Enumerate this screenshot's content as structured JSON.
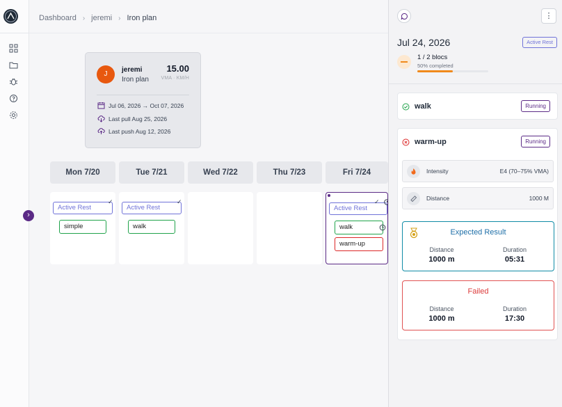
{
  "breadcrumb": {
    "items": [
      "Dashboard",
      "jeremi",
      "Iron plan"
    ]
  },
  "athlete": {
    "initial": "J",
    "name": "jeremi",
    "plan": "Iron plan",
    "vma": "15.00",
    "vma_unit": "VMA · KM/H",
    "date_range": "Jul 06, 2026 → Oct 07, 2026",
    "last_pull": "Last pull Aug 25, 2026",
    "last_push": "Last push Aug 12, 2026"
  },
  "calendar": {
    "days": [
      {
        "label": "Mon 7/20",
        "rest": "Active Rest",
        "sessions": [
          {
            "name": "simple",
            "status": "ok"
          }
        ]
      },
      {
        "label": "Tue 7/21",
        "rest": "Active Rest",
        "sessions": [
          {
            "name": "walk",
            "status": "ok"
          }
        ]
      },
      {
        "label": "Wed 7/22"
      },
      {
        "label": "Thu 7/23"
      },
      {
        "label": "Fri 7/24",
        "rest": "Active Rest",
        "sessions": [
          {
            "name": "walk",
            "status": "ok"
          },
          {
            "name": "warm-up",
            "status": "failed"
          }
        ]
      }
    ],
    "expand_icon": "chevron-right-icon"
  },
  "panel": {
    "date": "Jul 24, 2026",
    "badge": "Active Rest",
    "progress": {
      "count": "1 / 2 blocs",
      "label": "50% completed",
      "fraction": 0.5
    },
    "blocks": [
      {
        "title": "walk",
        "type": "Running",
        "status": "success"
      },
      {
        "title": "warm-up",
        "type": "Running",
        "status": "failed"
      }
    ],
    "metrics": [
      {
        "label": "Intensity",
        "value": "E4 (70–75% VMA)",
        "icon": "flame-icon"
      },
      {
        "label": "Distance",
        "value": "1000 M",
        "icon": "ruler-icon"
      }
    ],
    "expected": {
      "title": "Expected Result",
      "distance_label": "Distance",
      "distance": "1000 m",
      "duration_label": "Duration",
      "duration": "05:31"
    },
    "failed": {
      "title": "Failed",
      "distance_label": "Distance",
      "distance": "1000 m",
      "duration_label": "Duration",
      "duration": "17:30"
    },
    "menu_icon": "⋮"
  },
  "colors": {
    "accent": "#5b2a86",
    "rest": "#6f72d8",
    "success": "#20a34a",
    "failed": "#dc2626",
    "progress": "#f08a1c"
  }
}
